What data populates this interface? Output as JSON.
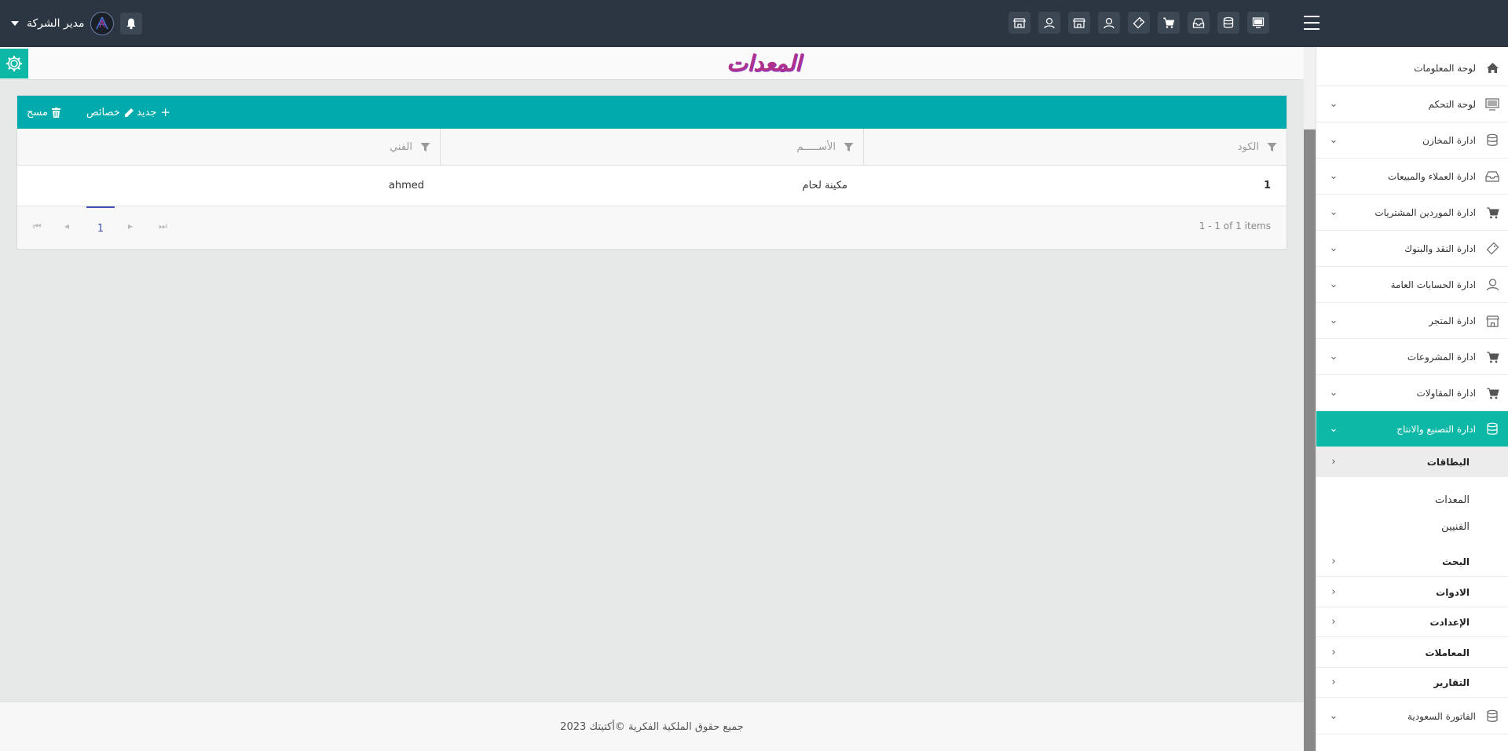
{
  "header": {
    "user_name": "مدير الشركة",
    "icons": [
      "monitor-icon",
      "database-icon",
      "inbox-icon",
      "cart-icon",
      "tag-icon",
      "user-icon",
      "store-icon",
      "user-icon",
      "store-icon"
    ]
  },
  "page": {
    "title": "المعدات"
  },
  "toolbar": {
    "new_label": "جديد",
    "props_label": "خصائص",
    "delete_label": "مسح"
  },
  "grid": {
    "columns": [
      "الكود",
      "الأســـــم",
      "الفني"
    ],
    "rows": [
      {
        "code": "1",
        "name": "مكينة لحام",
        "technician": "ahmed"
      }
    ],
    "pager": {
      "current_page": "1",
      "info": "1 - 1 of 1 items"
    }
  },
  "footer": {
    "copyright": "جميع حقوق الملكية الفكرية ©أكتيتك 2023"
  },
  "sidebar": {
    "items": [
      {
        "label": "لوحة المعلومات",
        "icon": "home-icon"
      },
      {
        "label": "لوحة التحكم",
        "icon": "monitor-icon"
      },
      {
        "label": "ادارة المخازن",
        "icon": "database-icon"
      },
      {
        "label": "ادارة العملاء والمبيعات",
        "icon": "inbox-icon"
      },
      {
        "label": "ادارة الموردين المشتريات",
        "icon": "cart-icon"
      },
      {
        "label": "ادارة النقد والبنوك",
        "icon": "tag-icon"
      },
      {
        "label": "ادارة الحسابات العامة",
        "icon": "user-icon"
      },
      {
        "label": "ادارة المتجر",
        "icon": "store-icon"
      },
      {
        "label": "ادارة المشروعات",
        "icon": "cart-icon"
      },
      {
        "label": "ادارة المقاولات",
        "icon": "cart-icon"
      },
      {
        "label": "ادارة التصنيع والانتاج",
        "icon": "database-icon",
        "active": true
      }
    ],
    "submenu": {
      "cards": "البطاقات",
      "cards_children": [
        "المعدات",
        "الفنيين"
      ],
      "groups": [
        "البحث",
        "الادوات",
        "الإعدادت",
        "المعاملات",
        "التقارير"
      ]
    },
    "last_item": {
      "label": "الفاتورة السعودية",
      "icon": "database-icon"
    }
  },
  "colors": {
    "topbar": "#2c3642",
    "accent": "#0eb8a6",
    "toolbar": "#00aaad",
    "title": "#b0308a"
  }
}
